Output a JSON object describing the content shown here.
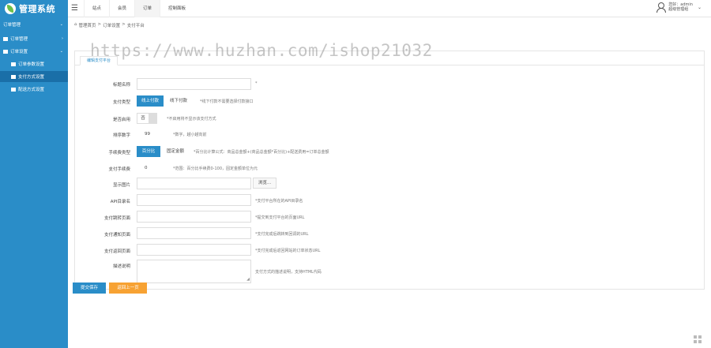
{
  "header": {
    "app_title": "管理系统",
    "nav_tabs": [
      "站点",
      "会员",
      "订单",
      "控制面板"
    ],
    "active_tab": "订单",
    "user_line1": "您好：admin",
    "user_line2": "超级管理组"
  },
  "sidebar": {
    "group_label": "订单管理",
    "items": [
      {
        "label": "订单管理"
      },
      {
        "label": "订单设置"
      },
      {
        "label": "订单参数设置"
      },
      {
        "label": "支付方式设置"
      },
      {
        "label": "配送方式设置"
      }
    ]
  },
  "breadcrumb": [
    "管理首页",
    ">",
    "订单设置",
    ">",
    "支付平台"
  ],
  "watermark": "https://www.huzhan.com/ishop21032",
  "panel": {
    "tab_label": "编辑支付平台"
  },
  "form": {
    "title": {
      "label": "标题名称",
      "value": "",
      "hint": "*"
    },
    "pay_type": {
      "label": "支付类型",
      "option_online": "线上付款",
      "option_offline": "线下付款",
      "hint": "*线下付款不需要选择付款接口"
    },
    "enabled": {
      "label": "是否启用",
      "switch_text": "否",
      "hint": "*不启用将不显示该支付方式"
    },
    "sort": {
      "label": "排序数字",
      "value": "99",
      "hint": "*数字，越小越向前"
    },
    "fee_type": {
      "label": "手续费类型",
      "option_percent": "百分比",
      "option_fixed": "固定金额",
      "hint": "*百分比计算公式：商品总金额+(商品总金额*百分比)+配送费用=订单总金额"
    },
    "fee": {
      "label": "支付手续费",
      "value": "0",
      "hint": "*范围：百分比手续费0-100，固定金额单位为元"
    },
    "image": {
      "label": "显示图片",
      "value": "",
      "browse_label": "浏览..."
    },
    "api_path": {
      "label": "API目录名",
      "value": "",
      "hint": "*支付平台所在的API目录名"
    },
    "redirect_page": {
      "label": "支付跳转页面",
      "value": "",
      "hint": "*提交到支付平台的页面URL"
    },
    "notify_page": {
      "label": "支付通知页面",
      "value": "",
      "hint": "*支付完成后跳转到回调的URL"
    },
    "return_page": {
      "label": "支付返回页面",
      "value": "",
      "hint": "*支付完成后返回网站的订单状态URL"
    },
    "remark": {
      "label": "描述说明",
      "value": "",
      "hint": "支付方式的描述说明，支持HTML代码"
    }
  },
  "actions": {
    "submit_label": "提交保存",
    "back_label": "返回上一页"
  },
  "colors": {
    "brand": "#2a8dc8",
    "orange": "#f7a233"
  }
}
